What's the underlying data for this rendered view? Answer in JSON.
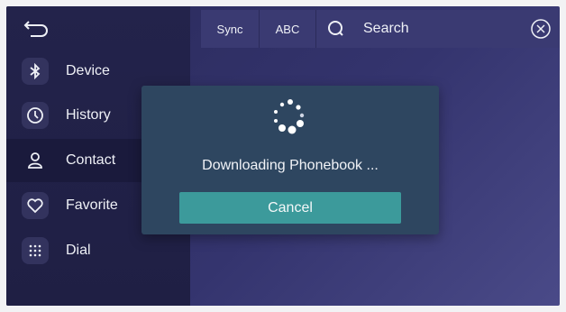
{
  "sidebar": {
    "back_icon": "back-arrow-icon",
    "items": [
      {
        "label": "Device",
        "icon": "bluetooth-icon"
      },
      {
        "label": "History",
        "icon": "clock-icon"
      },
      {
        "label": "Contact",
        "icon": "person-icon",
        "active": true
      },
      {
        "label": "Favorite",
        "icon": "heart-icon"
      },
      {
        "label": "Dial",
        "icon": "dialpad-icon"
      }
    ]
  },
  "topbar": {
    "sync_label": "Sync",
    "abc_label": "ABC",
    "search_label": "Search",
    "search_icon": "search-icon",
    "clear_icon": "close-circle-icon"
  },
  "dialog": {
    "message": "Downloading Phonebook ...",
    "cancel_label": "Cancel",
    "spinner_icon": "loading-spinner-icon"
  },
  "colors": {
    "background": "#34346e",
    "sidebar": "#23234b",
    "sidebar_active": "#1a1a3c",
    "dialog": "#2e4660",
    "cancel_button": "#3c9a9b"
  }
}
